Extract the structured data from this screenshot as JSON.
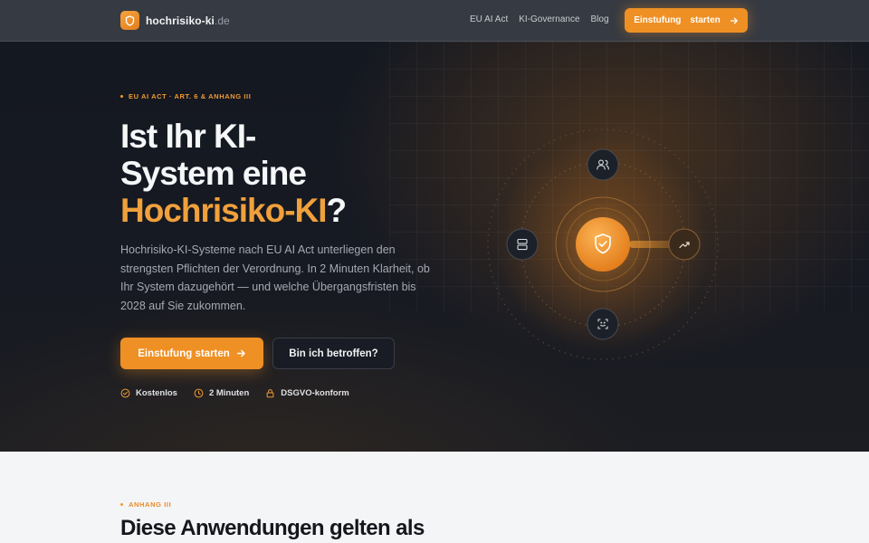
{
  "nav": {
    "brand": "hochrisiko-ki",
    "brand_tld": ".de",
    "links": [
      "EU AI Act",
      "KI-Governance",
      "Blog"
    ],
    "cta_label": "Einstufung",
    "cta_label_2": "starten"
  },
  "hero": {
    "eyebrow": "EU AI ACT · ART. 6 & ANHANG III",
    "headline_line1": "Ist Ihr KI-",
    "headline_line2": "System eine",
    "headline_accent": "Hochrisiko-KI",
    "headline_end": "?",
    "lead": "Hochrisiko-KI-Systeme nach EU AI Act unterliegen den strengsten Pflichten der Verordnung. In 2 Minuten Klarheit, ob Ihr System dazugehört — und welche Übergangsfristen bis 2028 auf Sie zukommen.",
    "primary_button": "Einstufung starten",
    "secondary_button": "Bin ich betroffen?",
    "trust": [
      {
        "icon": "check-circle-icon",
        "label": "Kostenlos"
      },
      {
        "icon": "clock-icon",
        "label": "2 Minuten"
      },
      {
        "icon": "lock-icon",
        "label": "DSGVO-konform"
      }
    ],
    "orbit_icons": [
      "shield-check-icon",
      "users-icon",
      "server-icon",
      "trending-up-icon",
      "face-scan-icon"
    ]
  },
  "section": {
    "eyebrow": "ANHANG III",
    "title": "Diese Anwendungen gelten als"
  },
  "colors": {
    "accent": "#ef9024",
    "hero_bg": "#151820",
    "nav_bg": "#363a42",
    "section_bg": "#f4f5f7"
  }
}
